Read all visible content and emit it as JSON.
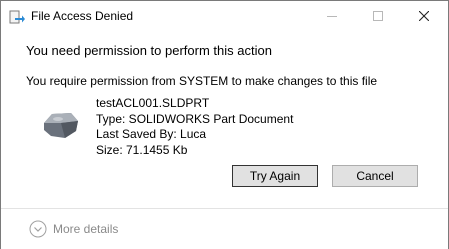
{
  "window": {
    "title": "File Access Denied",
    "app_icon": "file-transfer-icon",
    "controls": [
      "minimize-icon",
      "maximize-icon",
      "close-icon"
    ]
  },
  "message": {
    "heading": "You need permission to perform this action",
    "subheading": "You require permission from SYSTEM to make changes to this file"
  },
  "file": {
    "icon": "solidworks-part-icon",
    "name": "testACL001.SLDPRT",
    "type": "Type: SOLIDWORKS Part Document",
    "last_saved": "Last Saved By: Luca",
    "size": "Size: 71.1455 Kb"
  },
  "buttons": {
    "try_again": "Try Again",
    "cancel": "Cancel"
  },
  "footer": {
    "more_details": "More details",
    "icon": "chevron-down-circle-icon"
  },
  "colors": {
    "button_face": "#e1e1e1",
    "close_glyph": "#222222",
    "disabled_glyph": "#b8b8b8"
  }
}
